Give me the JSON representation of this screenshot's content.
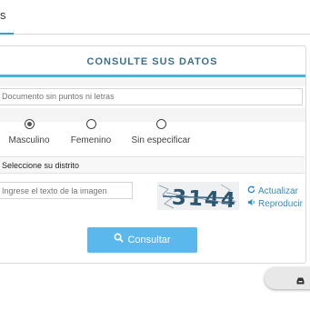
{
  "tabs": {
    "active_label": "s"
  },
  "card": {
    "title": "CONSULTE SUS DATOS",
    "document_input": {
      "placeholder": "Documento sin puntos ni letras",
      "value": ""
    },
    "gender": {
      "options": [
        {
          "label": "Masculino",
          "checked": true
        },
        {
          "label": "Femenino",
          "checked": false
        },
        {
          "label": "Sin especificar",
          "checked": false
        }
      ]
    },
    "district_select": {
      "selected": "Seleccione su distrito"
    },
    "captcha": {
      "input_placeholder": "Ingrese el texto de la imagen",
      "image_text": "3144",
      "refresh_label": "Actualizar",
      "audio_label": "Reproducir",
      "refresh_icon": "refresh-icon",
      "audio_icon": "speaker-icon"
    },
    "submit": {
      "label": "Consultar",
      "icon": "search-icon"
    }
  },
  "floating_button": {
    "icon": "inbox-icon"
  },
  "colors": {
    "accent": "#4fb0dc",
    "button": "#5bb8ec",
    "link": "#2f8fc7",
    "title": "#3f6f85"
  }
}
